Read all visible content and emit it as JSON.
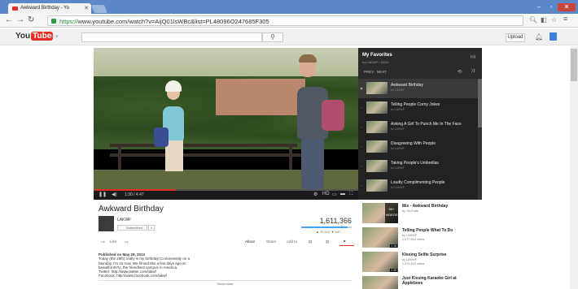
{
  "browser": {
    "tab_title": "Awkward Birthday - Yo",
    "url_https": "https://",
    "url_rest": "www.youtube.com/watch?v=AijQ01lsWBc&list=PL48096O247685F305"
  },
  "youtube": {
    "logo_you": "You",
    "logo_tube": "Tube",
    "upload_label": "Upload"
  },
  "video": {
    "title": "Awkward Birthday",
    "time": "1:30 / 4:47",
    "progress_fraction": 0.31,
    "channel": "LAKWF",
    "subscribe_label": "Subscribed",
    "sub_count": "0",
    "views": "1,611,366",
    "likes_fraction": 0.92,
    "likes": "▲ 20,312",
    "dislikes": "▼ 547",
    "actions": {
      "like": "Like",
      "about": "About",
      "share": "Share",
      "add_to": "Add to"
    },
    "description": {
      "published": "Published on May 29, 2013",
      "line1": "Today (the 29th) really is my birthday! Conveniently on a",
      "line2": "Monday. I'm 23 now. We filmed this a few days ago at",
      "line3": "beautiful BYU, the friendliest campus in America.",
      "line4": "Twitter: http://www.twitter.com/lakwf",
      "line5": "Facebook: http://www.facebook.com/lakwf"
    },
    "show_more": "Show more"
  },
  "playlist": {
    "title": "My Favorites",
    "meta": "by LAKWF • 52/51",
    "count_a": "PREV",
    "count_b": "NEXT",
    "items": [
      {
        "title": "Awkward Birthday",
        "by": "by LAKWF"
      },
      {
        "title": "Telling People Corny Jokes",
        "by": "by LAKWF"
      },
      {
        "title": "Asking A Girl To Punch Me In The Face",
        "by": "by LAKWF"
      },
      {
        "title": "Disagreeing With People",
        "by": "by LAKWF"
      },
      {
        "title": "Taking People's Umbrellas",
        "by": "by LAKWF"
      },
      {
        "title": "Loudly Complimenting People",
        "by": "by LAKWF"
      }
    ]
  },
  "related": [
    {
      "title": "Mix - Awkward Birthday",
      "by": "by YouTube",
      "views": "",
      "mix": "50+ VIDEOS"
    },
    {
      "title": "Telling People What To Do",
      "by": "by LAKWF",
      "views": "1,077,803 views",
      "dur": "2:15"
    },
    {
      "title": "Kissing Selfie Surprise",
      "by": "by LAKWF",
      "views": "1,974,823 views",
      "dur": "2:35"
    },
    {
      "title": "Just Kissing Karaoke Girl at Applebees",
      "by": "",
      "views": "",
      "dur": ""
    }
  ]
}
